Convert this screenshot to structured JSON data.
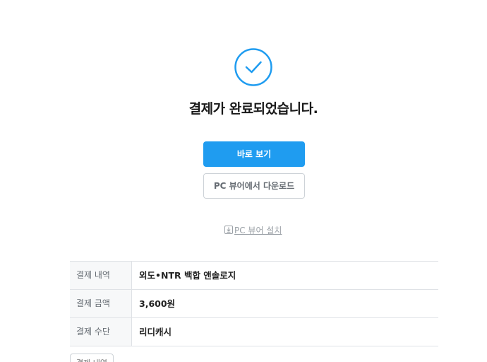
{
  "result": {
    "icon": "check-circle-icon",
    "title": "결제가 완료되었습니다."
  },
  "actions": {
    "view_now_label": "바로 보기",
    "pc_download_label": "PC 뷰어에서 다운로드",
    "install_icon": "download-icon",
    "install_label": "PC 뷰어 설치"
  },
  "payment": {
    "rows": [
      {
        "label": "결제 내역",
        "value": "외도•NTR 백합 앤솔로지"
      },
      {
        "label": "결제 금액",
        "value": "3,600원"
      },
      {
        "label": "결제 수단",
        "value": "리디캐시"
      }
    ],
    "history_label": "결제 내역"
  },
  "colors": {
    "accent": "#1f9cf0",
    "border": "#dfe2e6",
    "label_bg": "#f7f8f9"
  }
}
